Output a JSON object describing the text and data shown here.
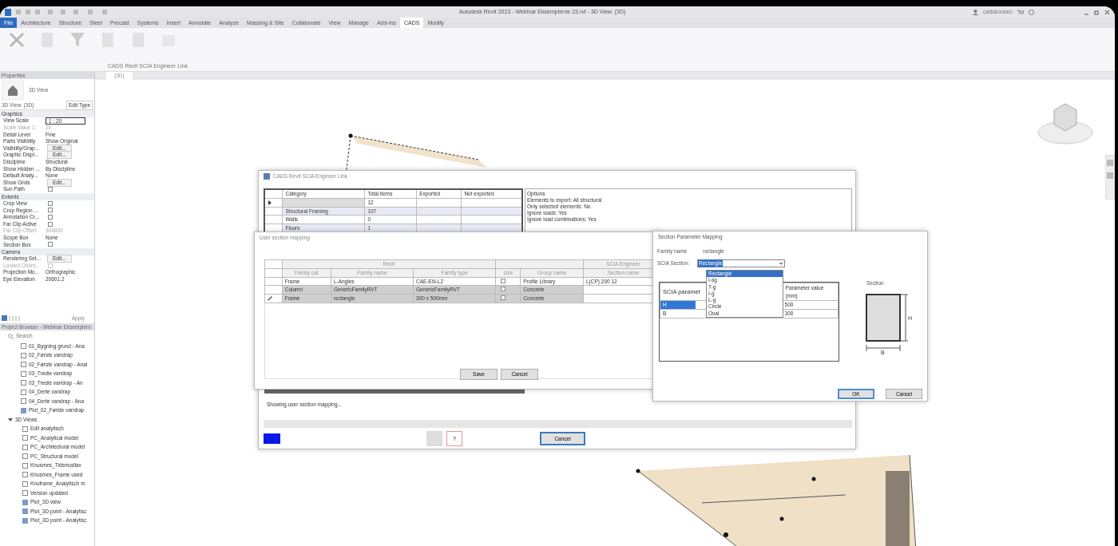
{
  "window": {
    "title": "Autodesk Revit 2023 - Webinar Eksemplerne 23.rvt - 3D View: {3D}",
    "user": "cadskonsec"
  },
  "ribbon": {
    "tabs": [
      {
        "label": "File",
        "selected": false,
        "kind": "file"
      },
      {
        "label": "Architecture",
        "selected": false,
        "kind": "tab"
      },
      {
        "label": "Structure",
        "selected": false,
        "kind": "tab"
      },
      {
        "label": "Steel",
        "selected": false,
        "kind": "tab"
      },
      {
        "label": "Precast",
        "selected": false,
        "kind": "tab"
      },
      {
        "label": "Systems",
        "selected": false,
        "kind": "tab"
      },
      {
        "label": "Insert",
        "selected": false,
        "kind": "tab"
      },
      {
        "label": "Annotate",
        "selected": false,
        "kind": "tab"
      },
      {
        "label": "Analyze",
        "selected": false,
        "kind": "tab"
      },
      {
        "label": "Massing & Site",
        "selected": false,
        "kind": "tab"
      },
      {
        "label": "Collaborate",
        "selected": false,
        "kind": "tab"
      },
      {
        "label": "View",
        "selected": false,
        "kind": "tab"
      },
      {
        "label": "Manage",
        "selected": false,
        "kind": "tab"
      },
      {
        "label": "Add-Ins",
        "selected": false,
        "kind": "tab"
      },
      {
        "label": "CADS",
        "selected": true,
        "kind": "tab"
      },
      {
        "label": "Modify",
        "selected": false,
        "kind": "tab"
      }
    ],
    "panel_title": "CADS Revit SCIA Engineer Link"
  },
  "properties": {
    "title": "Properties",
    "type_name": "3D View",
    "instance": "3D View: {3D}",
    "edit_type": "Edit Type",
    "groups": [
      {
        "name": "Graphics",
        "rows": [
          {
            "label": "View Scale",
            "value": "1 : 20",
            "kind": "field",
            "disabled": false
          },
          {
            "label": "Scale Value 1:",
            "value": "20",
            "kind": "text",
            "disabled": true
          },
          {
            "label": "Detail Level",
            "value": "Fine",
            "kind": "text",
            "disabled": false
          },
          {
            "label": "Parts Visibility",
            "value": "Show Original",
            "kind": "text",
            "disabled": false
          },
          {
            "label": "Visibility/Grap...",
            "value": "Edit...",
            "kind": "button",
            "disabled": false
          },
          {
            "label": "Graphic Displ...",
            "value": "Edit...",
            "kind": "button",
            "disabled": false
          },
          {
            "label": "Discipline",
            "value": "Structural",
            "kind": "text",
            "disabled": false
          },
          {
            "label": "Show Hidden ...",
            "value": "By Discipline",
            "kind": "text",
            "disabled": false
          },
          {
            "label": "Default Analy...",
            "value": "None",
            "kind": "text",
            "disabled": false
          },
          {
            "label": "Show Grids",
            "value": "Edit...",
            "kind": "button",
            "disabled": false
          },
          {
            "label": "Sun Path",
            "kind": "checkbox",
            "checked": false,
            "disabled": false
          }
        ]
      },
      {
        "name": "Extents",
        "rows": [
          {
            "label": "Crop View",
            "kind": "checkbox",
            "checked": false,
            "disabled": false
          },
          {
            "label": "Crop Region ...",
            "kind": "checkbox",
            "checked": false,
            "disabled": false
          },
          {
            "label": "Annotation Cr...",
            "kind": "checkbox",
            "checked": false,
            "disabled": false
          },
          {
            "label": "Far Clip Active",
            "kind": "checkbox",
            "checked": false,
            "disabled": false
          },
          {
            "label": "Far Clip Offset",
            "value": "304800",
            "kind": "text",
            "disabled": true
          },
          {
            "label": "Scope Box",
            "value": "None",
            "kind": "text",
            "disabled": false
          },
          {
            "label": "Section Box",
            "kind": "checkbox",
            "checked": false,
            "disabled": false
          }
        ]
      },
      {
        "name": "Camera",
        "rows": [
          {
            "label": "Rendering Set...",
            "value": "Edit...",
            "kind": "button",
            "disabled": false
          },
          {
            "label": "Locked Orient...",
            "kind": "checkbox",
            "checked": false,
            "disabled": true
          },
          {
            "label": "Projection Mo...",
            "value": "Orthographic",
            "kind": "text",
            "disabled": false
          },
          {
            "label": "Eye Elevation",
            "value": "20601.2",
            "kind": "text",
            "disabled": false
          }
        ]
      }
    ],
    "apply": "Apply"
  },
  "project_browser": {
    "title": "Project Browser - Webinar Eksemplern",
    "search_placeholder": "Search",
    "items": [
      {
        "label": "01_Bygning grund - Ana",
        "kind": "view"
      },
      {
        "label": "02_Første vandrap",
        "kind": "view"
      },
      {
        "label": "02_Første vandrap - Anal",
        "kind": "view"
      },
      {
        "label": "03_Tredie vandrap",
        "kind": "view"
      },
      {
        "label": "03_Tredie vandrap - An",
        "kind": "view"
      },
      {
        "label": "04_Derte vandrap",
        "kind": "view"
      },
      {
        "label": "04_Derte vandrap - Ana",
        "kind": "view"
      },
      {
        "label": "Plot_02_Første vandrap",
        "kind": "sheet"
      },
      {
        "label": "3D Views",
        "kind": "group",
        "expanded": true,
        "children": [
          {
            "label": "Edit analytisch",
            "kind": "view"
          },
          {
            "label": "PC_Analytical model",
            "kind": "view"
          },
          {
            "label": "PC_Architectural model",
            "kind": "view"
          },
          {
            "label": "PC_Structural model",
            "kind": "view"
          },
          {
            "label": "Knusmes_Tidsmodlav",
            "kind": "view"
          },
          {
            "label": "Knusmes_Frame used",
            "kind": "view"
          },
          {
            "label": "Knuframe_Analytisch m",
            "kind": "view"
          },
          {
            "label": "Version updated",
            "kind": "view"
          },
          {
            "label": "Plot_3D view",
            "kind": "sheet"
          },
          {
            "label": "Plot_3D point - Analytisc",
            "kind": "sheet"
          },
          {
            "label": "Plot_3D point - Analytisc",
            "kind": "sheet"
          }
        ]
      }
    ]
  },
  "view_tab": {
    "label": "{3D}"
  },
  "main_dialog": {
    "title": "CADS Revit SCIA Engineer Link",
    "columns": [
      "Category",
      "Total items",
      "Exported",
      "Not exported"
    ],
    "rows": [
      {
        "cells": [
          "",
          "12",
          "",
          ""
        ],
        "selected": true
      },
      {
        "cells": [
          "Structural Framing",
          "107",
          "",
          ""
        ],
        "selected": false
      },
      {
        "cells": [
          "Walls",
          "0",
          "",
          ""
        ],
        "selected": false
      },
      {
        "cells": [
          "Floors",
          "1",
          "",
          ""
        ],
        "selected": false
      }
    ],
    "options": [
      "Options",
      "Elements to export: All structural",
      "Only selected elements: No",
      "Ignore loads: Yes",
      "Ignore load combinations: Yes"
    ],
    "progress": {
      "level": 0
    },
    "status": "Showing user section mapping...",
    "help": "?",
    "cancel": "Cancel"
  },
  "mapping_dialog": {
    "title": "User section mapping",
    "groups": [
      {
        "label": "Revit",
        "columns": [
          "Family cat",
          "Family name",
          "Family type"
        ]
      },
      {
        "columns": [
          "Use",
          "Group name"
        ]
      },
      {
        "label": "SCIA Engineer",
        "columns": [
          "Section name"
        ]
      }
    ],
    "rows": [
      {
        "cells": [
          "Frame",
          "L-Angles",
          "CAE-EN-L2",
          "",
          "Profile Library",
          "L(CP) 200 12"
        ],
        "use": false,
        "selected": false,
        "editing": false
      },
      {
        "cells": [
          "Column",
          "GenericFamilyRVT",
          "GenericFamilyRVT",
          "",
          "Concrete",
          ""
        ],
        "use": false,
        "selected": true,
        "editing": false
      },
      {
        "cells": [
          "Frame",
          "rectangle",
          "300 x 500mm",
          "",
          "Concrete",
          ""
        ],
        "use": false,
        "selected": true,
        "editing": true
      }
    ],
    "save": "Save",
    "cancel": "Cancel"
  },
  "section_dialog": {
    "title": "Section Parameter Mapping",
    "family_label": "Family name",
    "family_value": "rectangle",
    "section_label": "SCIA Section:",
    "section_value": "Rectangle",
    "options": [
      {
        "label": "Rectangle",
        "selected": true
      },
      {
        "label": "I-sg",
        "selected": false
      },
      {
        "label": "T-g",
        "selected": false
      },
      {
        "label": "I-g",
        "selected": false
      },
      {
        "label": "L-g",
        "selected": false
      },
      {
        "label": "Circle",
        "selected": false
      },
      {
        "label": "Oval",
        "selected": false
      }
    ],
    "columns": [
      "SCIA paramet",
      "Parameter value (mm)"
    ],
    "rows": [
      {
        "name": "H",
        "value": "500",
        "selected": true
      },
      {
        "name": "B",
        "value": "300",
        "selected": false
      }
    ],
    "preview_title": "Section",
    "dim_h": "H",
    "dim_b": "B",
    "ok": "OK",
    "cancel": "Cancel"
  }
}
